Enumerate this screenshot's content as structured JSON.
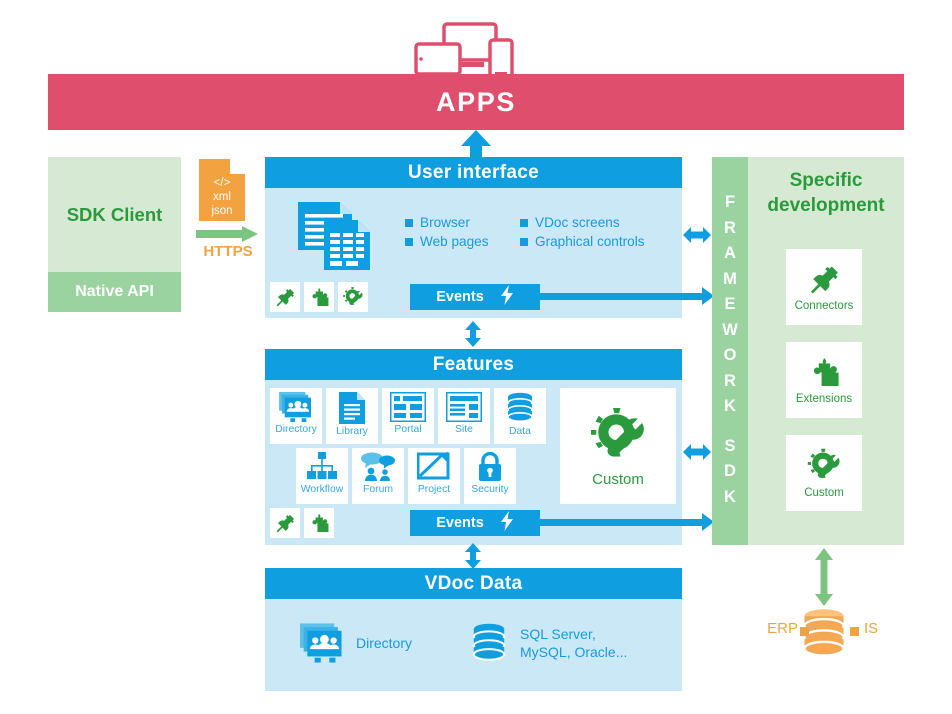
{
  "diagram": {
    "apps": {
      "label": "APPS",
      "icon": "devices-icon",
      "color": "#e04e6e"
    },
    "sdk_client": {
      "title": "SDK Client",
      "native_api": "Native API",
      "transport": {
        "format_icon_lines": [
          "</>",
          "xml",
          "json"
        ],
        "protocol": "HTTPS"
      },
      "color": "#2a9a3d"
    },
    "user_interface": {
      "title": "User interface",
      "doc_icon": "documents-icon",
      "bullets": [
        "Browser",
        "VDoc screens",
        "Web pages",
        "Graphical controls"
      ],
      "plugins": [
        "plug-icon",
        "puzzle-icon",
        "gear-wrench-icon"
      ],
      "events_label": "Events",
      "events_icon": "lightning-bolt-icon"
    },
    "features": {
      "title": "Features",
      "row1": [
        {
          "label": "Directory",
          "icon": "directory-icon"
        },
        {
          "label": "Library",
          "icon": "document-icon"
        },
        {
          "label": "Portal",
          "icon": "portal-layout-icon"
        },
        {
          "label": "Site",
          "icon": "site-layout-icon"
        },
        {
          "label": "Data",
          "icon": "database-icon"
        }
      ],
      "row2": [
        {
          "label": "Workflow",
          "icon": "workflow-tree-icon"
        },
        {
          "label": "Forum",
          "icon": "forum-speech-icon"
        },
        {
          "label": "Project",
          "icon": "project-pencil-icon"
        },
        {
          "label": "Security",
          "icon": "padlock-icon"
        }
      ],
      "custom": {
        "label": "Custom",
        "icon": "gear-wrench-icon"
      },
      "plugins": [
        "plug-icon",
        "puzzle-icon"
      ],
      "events_label": "Events",
      "events_icon": "lightning-bolt-icon"
    },
    "vdoc_data": {
      "title": "VDoc Data",
      "items": [
        {
          "label": "Directory",
          "icon": "directory-icon"
        },
        {
          "label": "SQL Server,\nMySQL, Oracle...",
          "icon": "database-icon"
        }
      ]
    },
    "framework": {
      "letters_top": [
        "F",
        "R",
        "A",
        "M",
        "E",
        "W",
        "O",
        "R",
        "K"
      ],
      "letters_bottom": [
        "S",
        "D",
        "K"
      ],
      "color": "#9bd3a0"
    },
    "specific_development": {
      "title_line1": "Specific",
      "title_line2": "development",
      "tiles": [
        {
          "label": "Connectors",
          "icon": "plug-icon"
        },
        {
          "label": "Extensions",
          "icon": "puzzle-icon"
        },
        {
          "label": "Custom",
          "icon": "gear-wrench-icon"
        }
      ],
      "color": "#2a9a3d"
    },
    "external_systems": {
      "left_label": "ERP",
      "right_label": "IS",
      "icon": "database-icon",
      "color": "#f2a33f"
    }
  }
}
